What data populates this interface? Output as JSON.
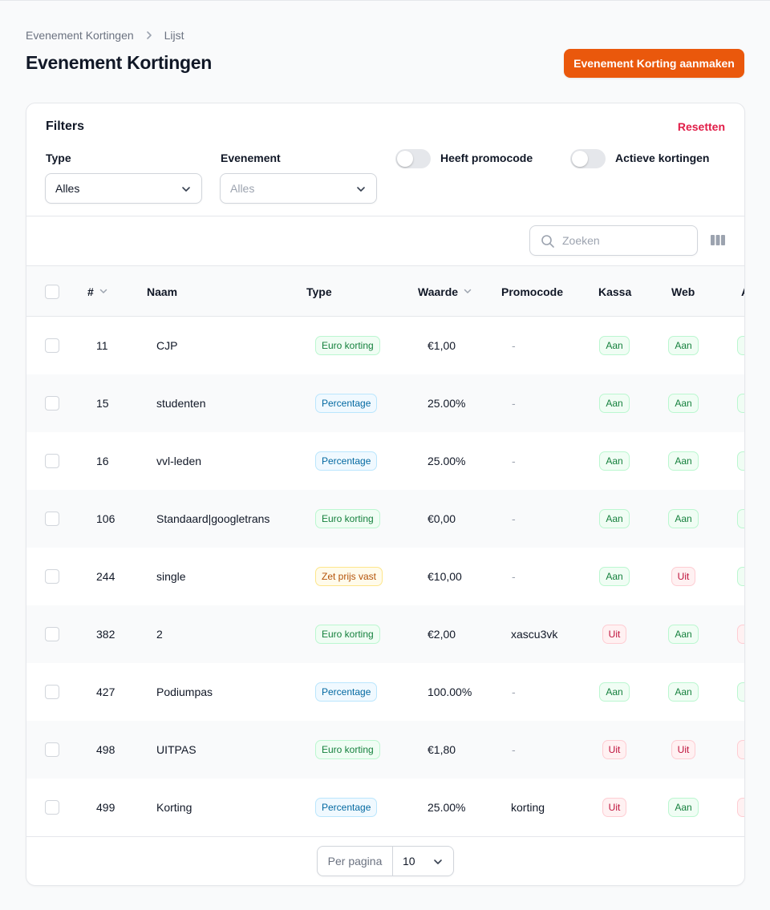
{
  "breadcrumb": {
    "items": [
      "Evenement Kortingen",
      "Lijst"
    ]
  },
  "page": {
    "title": "Evenement Kortingen",
    "create_button": "Evenement Korting aanmaken"
  },
  "filters": {
    "title": "Filters",
    "reset": "Resetten",
    "type": {
      "label": "Type",
      "value": "Alles"
    },
    "event": {
      "label": "Evenement",
      "placeholder": "Alles"
    },
    "toggle_promocode": {
      "label": "Heeft promocode",
      "on": false
    },
    "toggle_active": {
      "label": "Actieve kortingen",
      "on": false
    }
  },
  "toolbar": {
    "search_placeholder": "Zoeken",
    "columns_icon": "columns-icon"
  },
  "table": {
    "columns": {
      "id": "#",
      "name": "Naam",
      "type": "Type",
      "value": "Waarde",
      "promocode": "Promocode",
      "kassa": "Kassa",
      "web": "Web",
      "extra": "A"
    },
    "rows": [
      {
        "id": "11",
        "name": "CJP",
        "type": "Euro korting",
        "type_color": "success",
        "value": "€1,00",
        "promocode": "-",
        "kassa": "Aan",
        "web": "Aan",
        "extra_color": "success"
      },
      {
        "id": "15",
        "name": "studenten",
        "type": "Percentage",
        "type_color": "info",
        "value": "25.00%",
        "promocode": "-",
        "kassa": "Aan",
        "web": "Aan",
        "extra_color": "success"
      },
      {
        "id": "16",
        "name": "vvl-leden",
        "type": "Percentage",
        "type_color": "info",
        "value": "25.00%",
        "promocode": "-",
        "kassa": "Aan",
        "web": "Aan",
        "extra_color": "success"
      },
      {
        "id": "106",
        "name": "Standaard|googletrans",
        "type": "Euro korting",
        "type_color": "success",
        "value": "€0,00",
        "promocode": "-",
        "kassa": "Aan",
        "web": "Aan",
        "extra_color": "success"
      },
      {
        "id": "244",
        "name": "single",
        "type": "Zet prijs vast",
        "type_color": "warning",
        "value": "€10,00",
        "promocode": "-",
        "kassa": "Aan",
        "web": "Uit",
        "extra_color": "success"
      },
      {
        "id": "382",
        "name": "2",
        "type": "Euro korting",
        "type_color": "success",
        "value": "€2,00",
        "promocode": "xascu3vk",
        "kassa": "Uit",
        "web": "Aan",
        "extra_color": "danger"
      },
      {
        "id": "427",
        "name": "Podiumpas",
        "type": "Percentage",
        "type_color": "info",
        "value": "100.00%",
        "promocode": "-",
        "kassa": "Aan",
        "web": "Aan",
        "extra_color": "success"
      },
      {
        "id": "498",
        "name": "UITPAS",
        "type": "Euro korting",
        "type_color": "success",
        "value": "€1,80",
        "promocode": "-",
        "kassa": "Uit",
        "web": "Uit",
        "extra_color": "danger"
      },
      {
        "id": "499",
        "name": "Korting",
        "type": "Percentage",
        "type_color": "info",
        "value": "25.00%",
        "promocode": "korting",
        "kassa": "Uit",
        "web": "Aan",
        "extra_color": "danger"
      }
    ]
  },
  "pagination": {
    "per_page_label": "Per pagina",
    "per_page_value": "10"
  },
  "colors": {
    "accent": "#ea580c",
    "reset": "#e11d48",
    "success": "#15803d",
    "info": "#0369a1",
    "warning": "#b45309",
    "danger": "#be123c"
  }
}
